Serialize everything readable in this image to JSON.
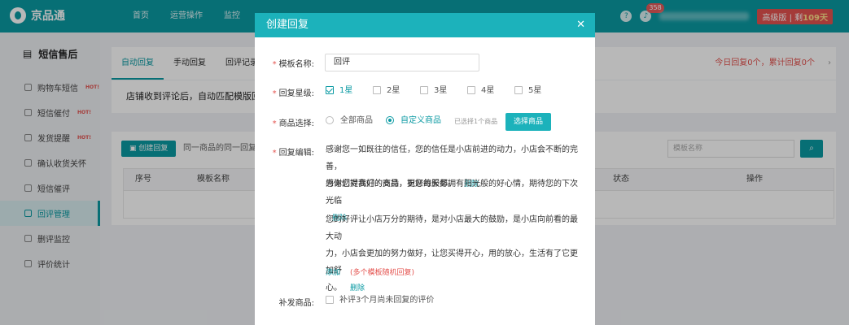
{
  "app": {
    "logo_text": "京品通"
  },
  "topnav": {
    "items": [
      "首页",
      "运营操作",
      "监控"
    ]
  },
  "topbar": {
    "bell_badge": "358",
    "plan_label": "高级版 | 剩",
    "plan_days": "109天"
  },
  "sidebar": {
    "title": "短信售后",
    "hot_label": "HOT!",
    "items": [
      {
        "label": "购物车短信",
        "hot": true
      },
      {
        "label": "短信催付",
        "hot": true
      },
      {
        "label": "发货提醒",
        "hot": true
      },
      {
        "label": "确认收货关怀",
        "hot": false
      },
      {
        "label": "短信催评",
        "hot": false
      },
      {
        "label": "回评管理",
        "hot": false,
        "active": true
      },
      {
        "label": "删评监控",
        "hot": false
      },
      {
        "label": "评价统计",
        "hot": false
      }
    ]
  },
  "main": {
    "tabs": [
      "自动回复",
      "手动回复",
      "回评记录"
    ],
    "tabs_right": "今日回复0个，累计回复0个",
    "description": "店铺收到评论后，自动匹配模版回",
    "create_button": "创建回复",
    "hint": "同一商品的同一回复",
    "search_placeholder": "模板名称",
    "table_headers": [
      "序号",
      "模板名称",
      "状态",
      "操作"
    ]
  },
  "modal": {
    "title": "创建回复",
    "template_name_label": "模板名称:",
    "template_name_value": "回评",
    "star_label": "回复星级:",
    "stars": [
      {
        "label": "1星",
        "checked": true
      },
      {
        "label": "2星",
        "checked": false
      },
      {
        "label": "3星",
        "checked": false
      },
      {
        "label": "4星",
        "checked": false
      },
      {
        "label": "5星",
        "checked": false
      }
    ],
    "goods_label": "商品选择:",
    "goods_options": [
      {
        "label": "全部商品",
        "selected": false
      },
      {
        "label": "自定义商品",
        "selected": true
      }
    ],
    "goods_selected_count": "已选择1个商品",
    "select_goods_button": "选择商品",
    "reply_label": "回复编辑:",
    "replies": [
      {
        "line1": "感谢您一如既往的信任，您的信任是小店前进的动力，小店会不断的完善，",
        "line2": "为你们提高好的商品，更好的服务。"
      },
      {
        "line1": "感谢您对我们的支持，祝您每天都拥有阳光般的好心情，期待您的下次光临",
        "line2": ""
      },
      {
        "line1": "您的好评让小店万分的期待，是对小店最大的鼓励，是小店向前看的最大动",
        "line2": "力，小店会更加的努力做好，让您买得开心，用的放心，生活有了它更加舒",
        "line3": "心。"
      }
    ],
    "delete_label": "删除",
    "add_label": "添加",
    "add_note": "(多个模板随机回复)",
    "resend_label": "补发商品:",
    "resend_option": "补评3个月尚未回复的评价"
  },
  "colors": {
    "brand": "#0b9aa3",
    "modal_header": "#1cb2bb",
    "danger": "#e4534f"
  }
}
